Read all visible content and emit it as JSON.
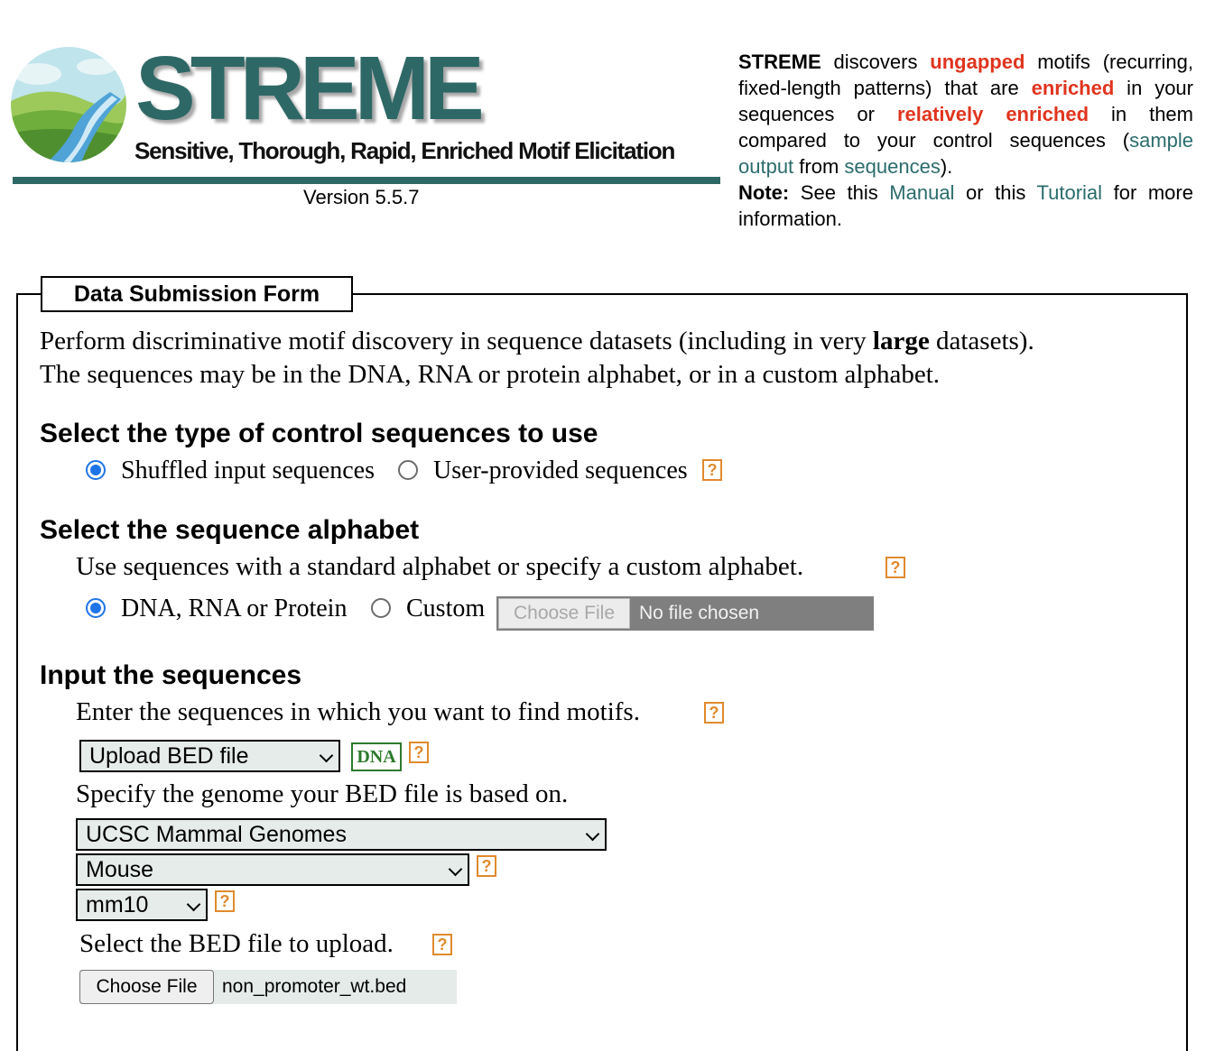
{
  "header": {
    "title": "STREME",
    "subtitle": "Sensitive, Thorough, Rapid, Enriched Motif Elicitation",
    "version": "Version 5.5.7"
  },
  "description": {
    "p1": "STREME",
    "p2": " discovers ",
    "p3": "ungapped",
    "p4": " motifs (recurring, fixed-length patterns) that are ",
    "p5": "enriched",
    "p6": " in your sequences or ",
    "p7": "relatively enriched",
    "p8": " in them compared to your control sequences (",
    "link_sample_output": "sample output",
    "p9": " from ",
    "link_sequences": "sequences",
    "p10": ").",
    "note_label": "Note:",
    "p11": " See this ",
    "link_manual": "Manual",
    "p12": " or this ",
    "link_tutorial": "Tutorial",
    "p13": " for more information."
  },
  "form": {
    "legend": "Data Submission Form",
    "intro_a": "Perform discriminative motif discovery in sequence datasets (including in very ",
    "intro_bold": "large",
    "intro_b": " datasets).",
    "intro_line2": "The sequences may be in the DNA, RNA or protein alphabet, or in a custom alphabet.",
    "control": {
      "title": "Select the type of control sequences to use",
      "option_shuffled": "Shuffled input sequences",
      "option_user": "User-provided sequences",
      "selected": "Shuffled input sequences"
    },
    "alphabet": {
      "title": "Select the sequence alphabet",
      "instruction": "Use sequences with a standard alphabet or specify a custom alphabet.",
      "option_standard": "DNA, RNA or Protein",
      "option_custom": "Custom",
      "selected": "DNA, RNA or Protein",
      "file_button": "Choose File",
      "file_status": "No file chosen"
    },
    "sequences": {
      "title": "Input the sequences",
      "instruction": "Enter the sequences in which you want to find motifs.",
      "input_method": "Upload BED file",
      "alphabet_badge": "DNA",
      "genome_instruction": "Specify the genome your BED file is based on.",
      "genome_category": "UCSC Mammal Genomes",
      "organism": "Mouse",
      "assembly": "mm10",
      "bed_instruction": "Select the BED file to upload.",
      "file_button": "Choose File",
      "file_name": "non_promoter_wt.bed"
    },
    "help_glyph": "?"
  },
  "colors": {
    "brand_teal": "#2e6866",
    "link_teal": "#2b6c6c",
    "emphasis_red": "#e0341e",
    "help_orange": "#e08a2e",
    "radio_blue": "#1f75e6",
    "dna_green": "#2c7a2c"
  },
  "icons": {
    "logo": "landscape-river-logo",
    "help": "question-mark-help-icon",
    "select_arrow": "chevron-down-icon"
  }
}
